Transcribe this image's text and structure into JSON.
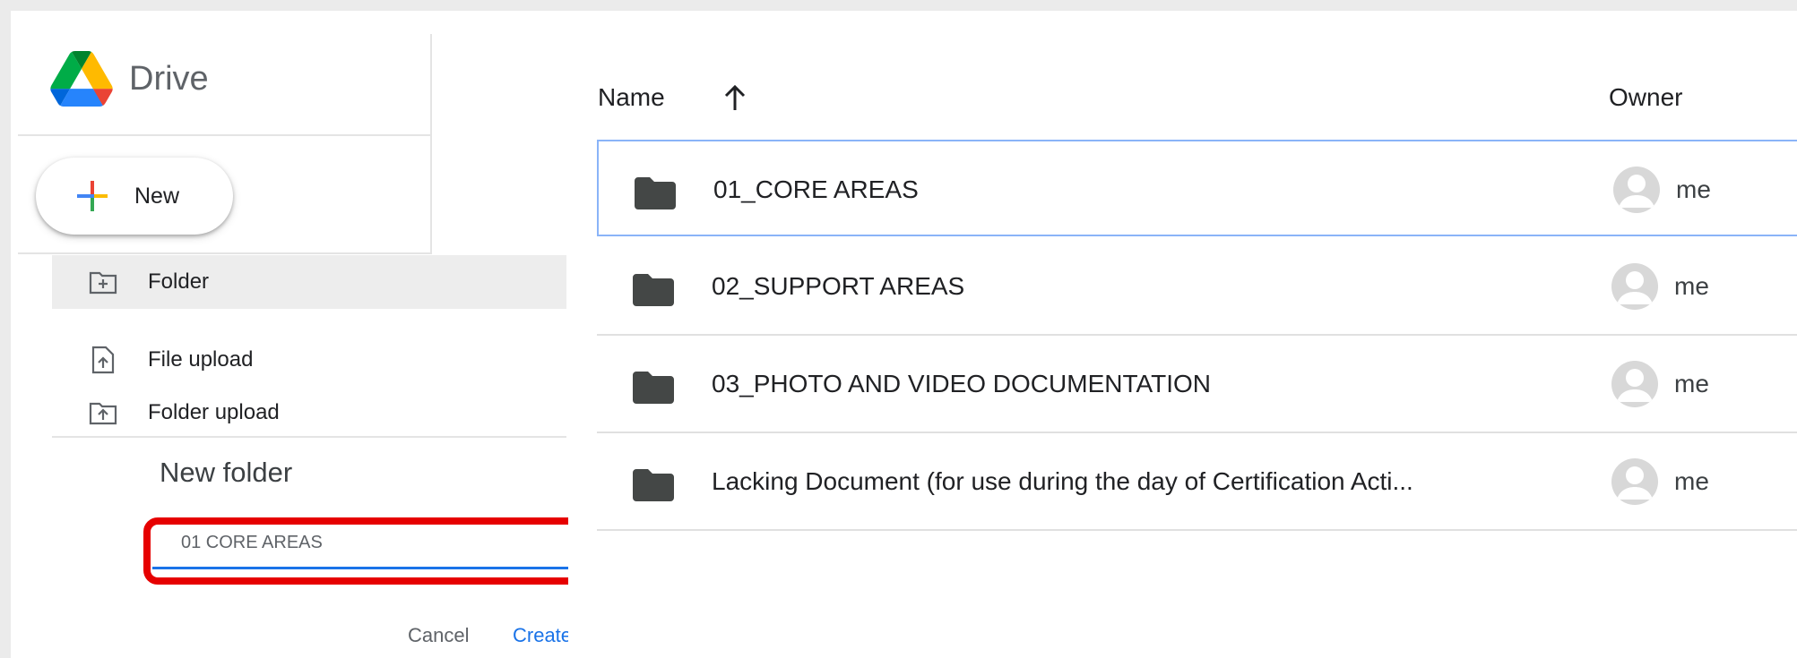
{
  "app": {
    "title": "Drive"
  },
  "new_menu": {
    "new_label": "New",
    "folder_label": "Folder",
    "file_upload_label": "File upload",
    "folder_upload_label": "Folder upload"
  },
  "dialog": {
    "title": "New folder",
    "input_value": "01 CORE AREAS",
    "cancel_label": "Cancel",
    "create_label": "Create"
  },
  "list": {
    "columns": {
      "name": "Name",
      "owner": "Owner"
    },
    "sort_icon": "arrow-up-icon",
    "rows": [
      {
        "name": "01_CORE AREAS",
        "owner": "me",
        "icon": "folder-icon"
      },
      {
        "name": "02_SUPPORT AREAS",
        "owner": "me",
        "icon": "folder-icon"
      },
      {
        "name": "03_PHOTO AND VIDEO DOCUMENTATION",
        "owner": "me",
        "icon": "folder-icon"
      },
      {
        "name": "Lacking Document (for use during the day of Certification Acti...",
        "owner": "me",
        "icon": "folder-icon"
      }
    ]
  },
  "colors": {
    "accent": "#1a73e8",
    "highlight": "#e60000",
    "selected_border": "#8ab4f8",
    "menu_hover": "#ededed"
  }
}
